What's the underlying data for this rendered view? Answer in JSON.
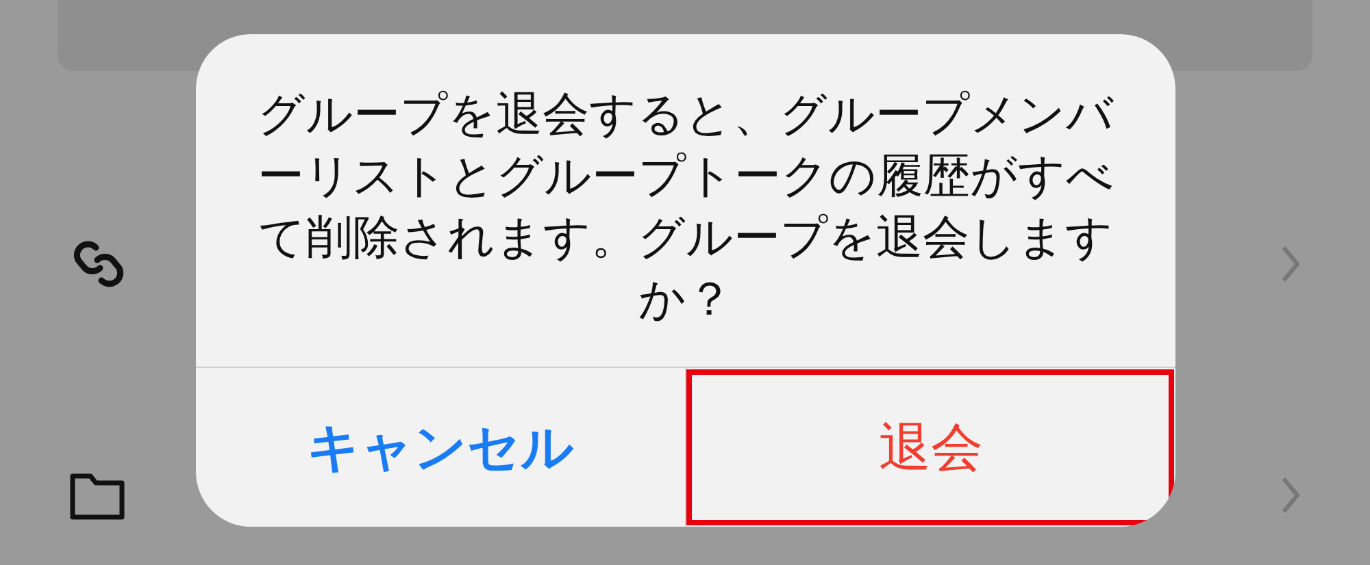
{
  "alert": {
    "message": "グループを退会すると、グループメンバーリストとグループトークの履歴がすべて削除されます。グループを退会しますか？",
    "buttons": [
      {
        "label": "キャンセル",
        "kind": "cancel",
        "highlighted": false
      },
      {
        "label": "退会",
        "kind": "destructive",
        "highlighted": true
      }
    ]
  }
}
